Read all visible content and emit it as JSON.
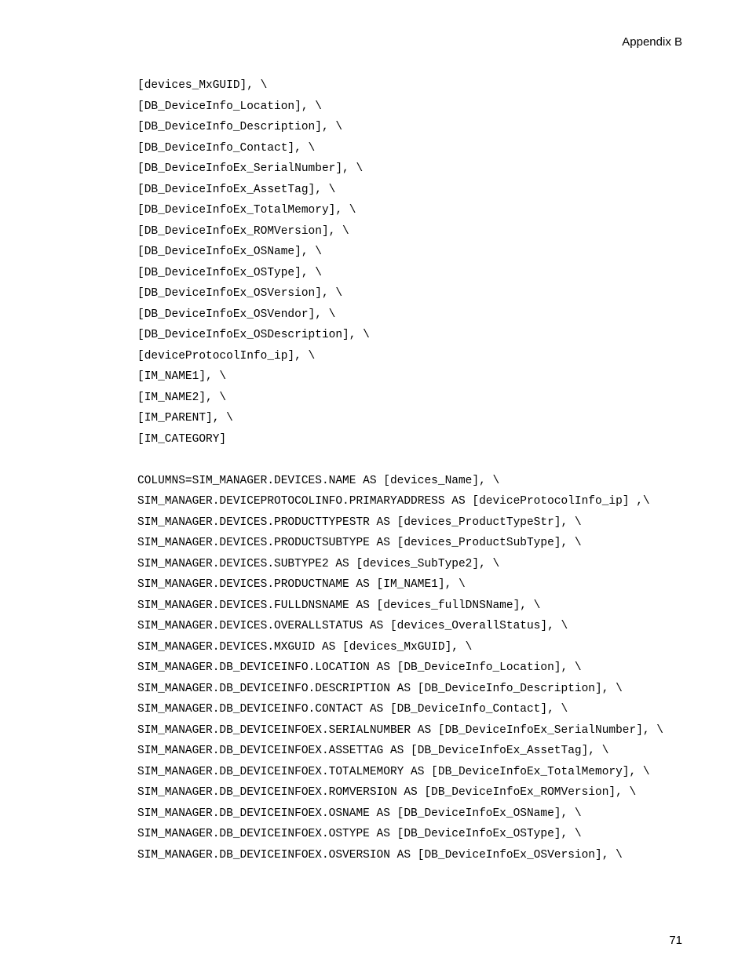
{
  "header": "Appendix B",
  "page_number": "71",
  "code_lines": [
    "[devices_MxGUID], \\",
    "[DB_DeviceInfo_Location], \\",
    "[DB_DeviceInfo_Description], \\",
    "[DB_DeviceInfo_Contact], \\",
    "[DB_DeviceInfoEx_SerialNumber], \\",
    "[DB_DeviceInfoEx_AssetTag], \\",
    "[DB_DeviceInfoEx_TotalMemory], \\",
    "[DB_DeviceInfoEx_ROMVersion], \\",
    "[DB_DeviceInfoEx_OSName], \\",
    "[DB_DeviceInfoEx_OSType], \\",
    "[DB_DeviceInfoEx_OSVersion], \\",
    "[DB_DeviceInfoEx_OSVendor], \\",
    "[DB_DeviceInfoEx_OSDescription], \\",
    "[deviceProtocolInfo_ip], \\",
    "[IM_NAME1], \\",
    "[IM_NAME2], \\",
    "[IM_PARENT], \\",
    "[IM_CATEGORY]",
    "",
    "COLUMNS=SIM_MANAGER.DEVICES.NAME AS [devices_Name], \\",
    "SIM_MANAGER.DEVICEPROTOCOLINFO.PRIMARYADDRESS AS [deviceProtocolInfo_ip] ,\\",
    "SIM_MANAGER.DEVICES.PRODUCTTYPESTR AS [devices_ProductTypeStr], \\",
    "SIM_MANAGER.DEVICES.PRODUCTSUBTYPE AS [devices_ProductSubType], \\",
    "SIM_MANAGER.DEVICES.SUBTYPE2 AS [devices_SubType2], \\",
    "SIM_MANAGER.DEVICES.PRODUCTNAME AS [IM_NAME1], \\",
    "SIM_MANAGER.DEVICES.FULLDNSNAME AS [devices_fullDNSName], \\",
    "SIM_MANAGER.DEVICES.OVERALLSTATUS AS [devices_OverallStatus], \\",
    "SIM_MANAGER.DEVICES.MXGUID AS [devices_MxGUID], \\",
    "SIM_MANAGER.DB_DEVICEINFO.LOCATION AS [DB_DeviceInfo_Location], \\",
    "SIM_MANAGER.DB_DEVICEINFO.DESCRIPTION AS [DB_DeviceInfo_Description], \\",
    "SIM_MANAGER.DB_DEVICEINFO.CONTACT AS [DB_DeviceInfo_Contact], \\",
    "SIM_MANAGER.DB_DEVICEINFOEX.SERIALNUMBER AS [DB_DeviceInfoEx_SerialNumber], \\",
    "SIM_MANAGER.DB_DEVICEINFOEX.ASSETTAG AS [DB_DeviceInfoEx_AssetTag], \\",
    "SIM_MANAGER.DB_DEVICEINFOEX.TOTALMEMORY AS [DB_DeviceInfoEx_TotalMemory], \\",
    "SIM_MANAGER.DB_DEVICEINFOEX.ROMVERSION AS [DB_DeviceInfoEx_ROMVersion], \\",
    "SIM_MANAGER.DB_DEVICEINFOEX.OSNAME AS [DB_DeviceInfoEx_OSName], \\",
    "SIM_MANAGER.DB_DEVICEINFOEX.OSTYPE AS [DB_DeviceInfoEx_OSType], \\",
    "SIM_MANAGER.DB_DEVICEINFOEX.OSVERSION AS [DB_DeviceInfoEx_OSVersion], \\"
  ]
}
